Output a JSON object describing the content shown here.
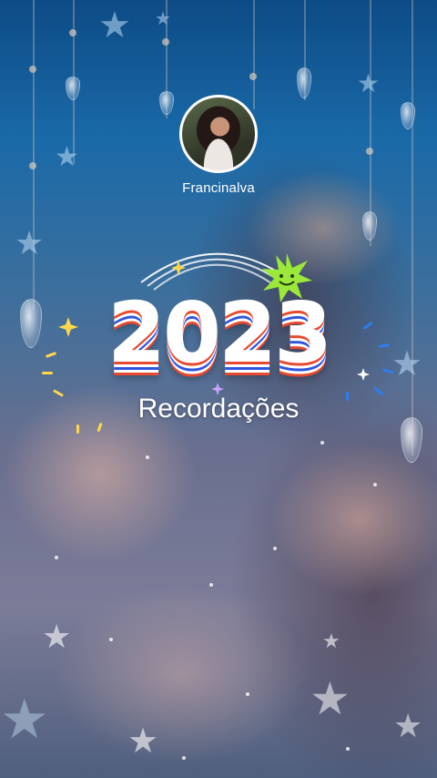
{
  "profile": {
    "name": "Francinalva"
  },
  "recap": {
    "year": "2023",
    "title": "Recordações"
  },
  "colors": {
    "accent_red": "#e8492f",
    "accent_blue": "#2f55e0",
    "sun_green": "#9be83a",
    "ray_yellow": "#ffd84a"
  },
  "icons": [
    "sun-smile-icon",
    "sparkle-icon",
    "star-icon",
    "rainbow-arc-icon"
  ]
}
